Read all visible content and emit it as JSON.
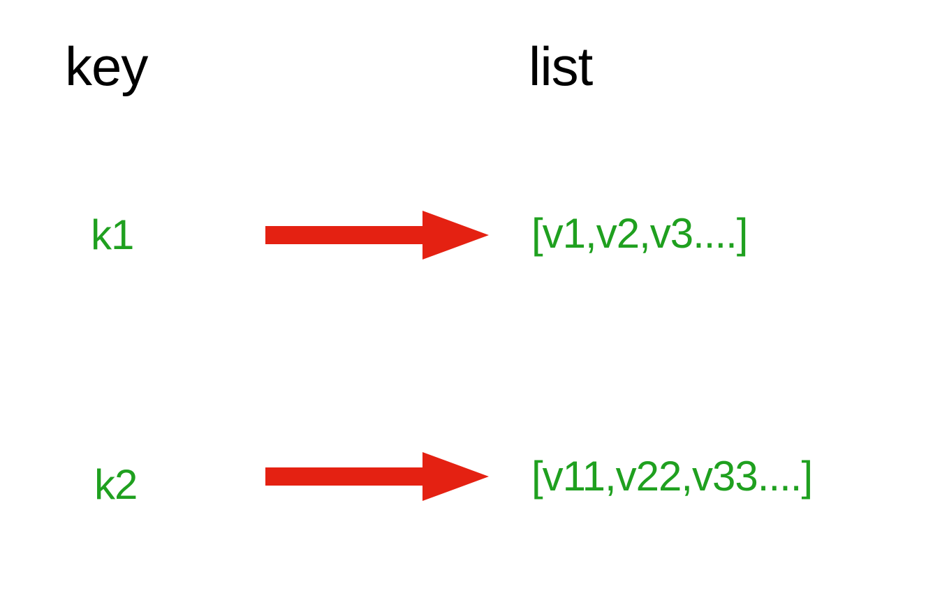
{
  "headers": {
    "key": "key",
    "list": "list"
  },
  "rows": [
    {
      "key": "k1",
      "list": "[v1,v2,v3....]"
    },
    {
      "key": "k2",
      "list": "[v11,v22,v33....]"
    }
  ],
  "colors": {
    "text_green": "#1fa01f",
    "arrow_red": "#e42112"
  }
}
